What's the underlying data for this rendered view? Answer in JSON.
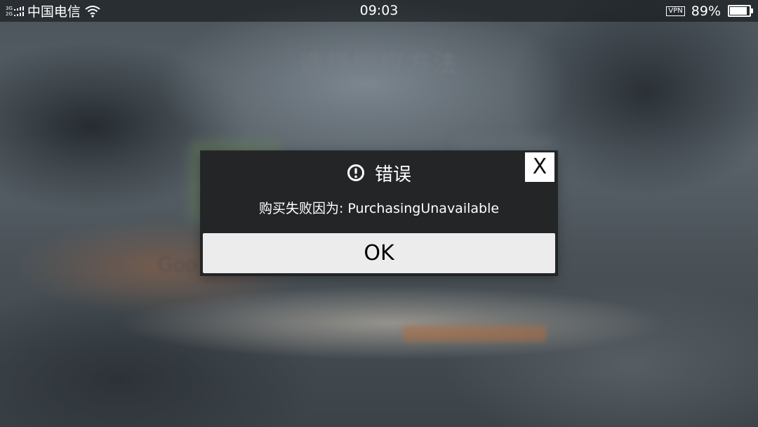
{
  "status_bar": {
    "network_top": "3G",
    "network_bottom": "2G",
    "carrier": "中国电信",
    "time": "09:03",
    "vpn": "VPN",
    "battery_percent": "89%",
    "battery_level": 0.89,
    "icons": [
      "signal-icon",
      "wifi-icon",
      "battery-icon"
    ]
  },
  "background": {
    "title": "选择授权方法",
    "provider_label": "Goo"
  },
  "dialog": {
    "title": "错误",
    "title_icon": "alert-circle-icon",
    "close_label": "X",
    "message": "购买失败因为: PurchasingUnavailable",
    "ok_label": "OK"
  },
  "colors": {
    "dialog_background": "#232527",
    "button_background": "#ececec",
    "text": "#ffffff"
  }
}
